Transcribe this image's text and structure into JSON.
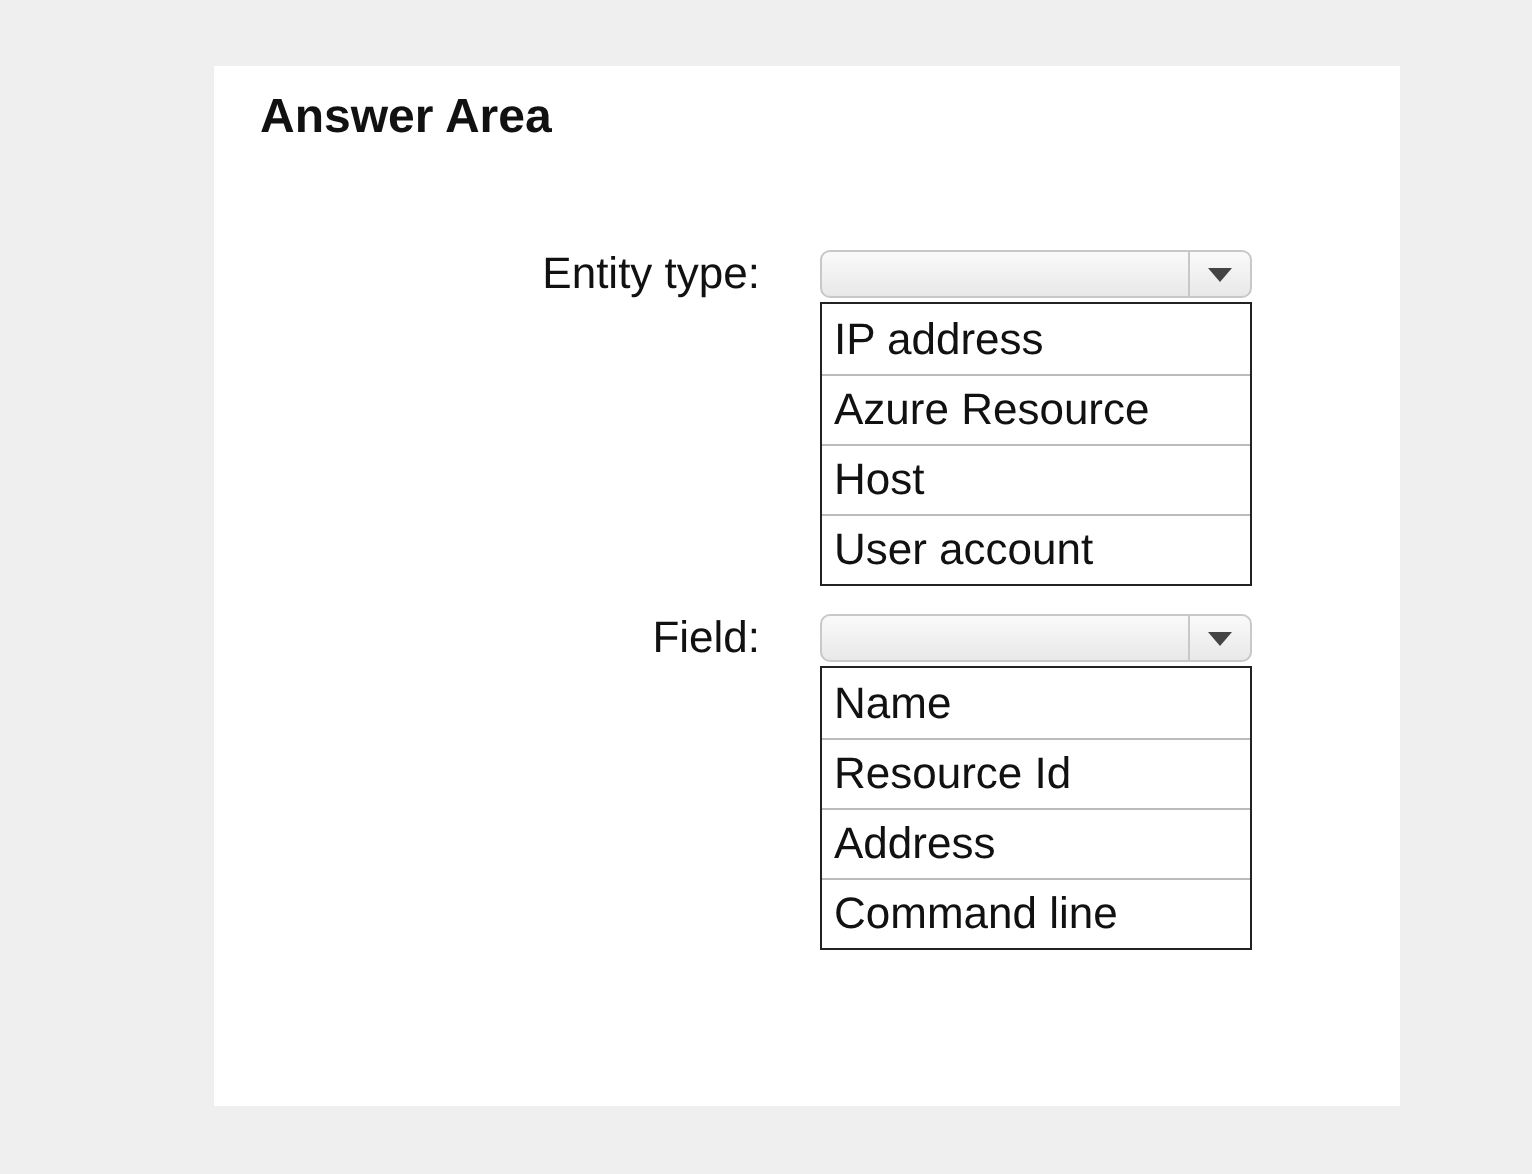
{
  "title": "Answer Area",
  "selects": [
    {
      "label": "Entity type:",
      "options": [
        "IP address",
        "Azure Resource",
        "Host",
        "User account"
      ]
    },
    {
      "label": "Field:",
      "options": [
        "Name",
        "Resource Id",
        "Address",
        "Command line"
      ]
    }
  ]
}
